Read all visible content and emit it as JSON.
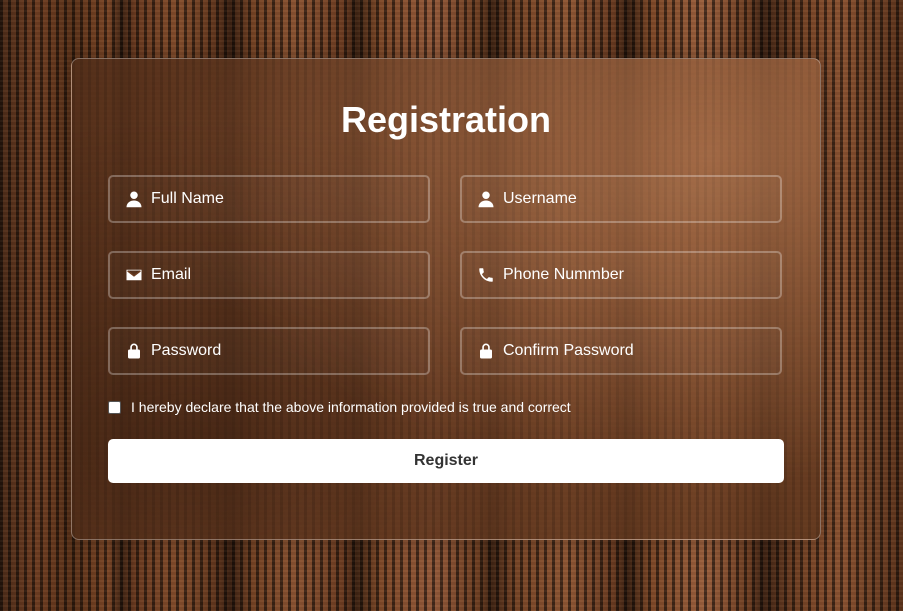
{
  "form": {
    "title": "Registration",
    "fields": [
      {
        "icon": "user-icon",
        "placeholder": "Full Name",
        "value": ""
      },
      {
        "icon": "user-icon",
        "placeholder": "Username",
        "value": ""
      },
      {
        "icon": "envelope-icon",
        "placeholder": "Email",
        "value": ""
      },
      {
        "icon": "phone-icon",
        "placeholder": "Phone Nummber",
        "value": ""
      },
      {
        "icon": "lock-icon",
        "placeholder": "Password",
        "value": ""
      },
      {
        "icon": "lock-icon",
        "placeholder": "Confirm Password",
        "value": ""
      }
    ],
    "declaration": {
      "label": "I hereby declare that the above information provided is true and correct",
      "checked": false
    },
    "submit_label": "Register"
  },
  "colors": {
    "text": "#ffffff",
    "button_bg": "#ffffff",
    "button_text": "#333333"
  }
}
